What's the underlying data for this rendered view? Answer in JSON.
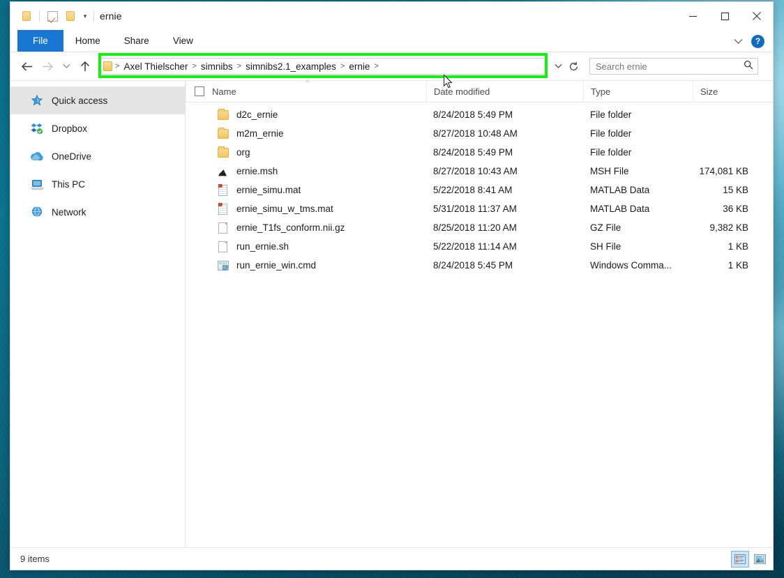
{
  "window": {
    "title": "ernie",
    "quick_access_icons": [
      "folder-icon",
      "properties-checkbox-icon",
      "new-folder-icon",
      "customize-caret-icon"
    ],
    "controls": {
      "minimize": "minimize-button",
      "maximize": "maximize-button",
      "close": "close-button"
    }
  },
  "ribbon": {
    "tabs": [
      {
        "label": "File",
        "active": true
      },
      {
        "label": "Home",
        "active": false
      },
      {
        "label": "Share",
        "active": false
      },
      {
        "label": "View",
        "active": false
      }
    ],
    "expand_icon": "chevron-down-icon",
    "help_label": "?"
  },
  "navbar": {
    "back_icon": "back-arrow-icon",
    "forward_icon": "forward-arrow-icon",
    "recent_icon": "chevron-down-icon",
    "up_icon": "up-arrow-icon",
    "breadcrumb": [
      "Axel Thielscher",
      "simnibs",
      "simnibs2.1_examples",
      "ernie"
    ],
    "breadcrumb_separator": ">",
    "dropdown_icon": "chevron-down-icon",
    "refresh_icon": "refresh-icon",
    "highlight_color": "#14f014"
  },
  "search": {
    "placeholder": "Search ernie",
    "value": "",
    "icon": "search-icon"
  },
  "sidebar": {
    "items": [
      {
        "label": "Quick access",
        "icon": "star-pin-icon",
        "selected": true
      },
      {
        "label": "Dropbox",
        "icon": "dropbox-icon",
        "selected": false
      },
      {
        "label": "OneDrive",
        "icon": "cloud-icon",
        "selected": false
      },
      {
        "label": "This PC",
        "icon": "computer-icon",
        "selected": false
      },
      {
        "label": "Network",
        "icon": "network-globe-icon",
        "selected": false
      }
    ]
  },
  "file_list": {
    "columns": [
      "Name",
      "Date modified",
      "Type",
      "Size"
    ],
    "sort_indicator": "^",
    "rows": [
      {
        "name": "d2c_ernie",
        "date": "8/24/2018 5:49 PM",
        "type": "File folder",
        "size": "",
        "icon": "folder-icon"
      },
      {
        "name": "m2m_ernie",
        "date": "8/27/2018 10:48 AM",
        "type": "File folder",
        "size": "",
        "icon": "folder-icon"
      },
      {
        "name": "org",
        "date": "8/24/2018 5:49 PM",
        "type": "File folder",
        "size": "",
        "icon": "folder-icon"
      },
      {
        "name": "ernie.msh",
        "date": "8/27/2018 10:43 AM",
        "type": "MSH File",
        "size": "174,081 KB",
        "icon": "msh-file-icon"
      },
      {
        "name": "ernie_simu.mat",
        "date": "5/22/2018 8:41 AM",
        "type": "MATLAB Data",
        "size": "15 KB",
        "icon": "matlab-file-icon"
      },
      {
        "name": "ernie_simu_w_tms.mat",
        "date": "5/31/2018 11:37 AM",
        "type": "MATLAB Data",
        "size": "36 KB",
        "icon": "matlab-file-icon"
      },
      {
        "name": "ernie_T1fs_conform.nii.gz",
        "date": "8/25/2018 11:20 AM",
        "type": "GZ File",
        "size": "9,382 KB",
        "icon": "generic-file-icon"
      },
      {
        "name": "run_ernie.sh",
        "date": "5/22/2018 11:14 AM",
        "type": "SH File",
        "size": "1 KB",
        "icon": "generic-file-icon"
      },
      {
        "name": "run_ernie_win.cmd",
        "date": "8/24/2018 5:45 PM",
        "type": "Windows Comma...",
        "size": "1 KB",
        "icon": "cmd-file-icon"
      }
    ]
  },
  "statusbar": {
    "item_count": "9 items",
    "views": [
      {
        "name": "details-view",
        "active": true
      },
      {
        "name": "large-icons-view",
        "active": false
      }
    ]
  }
}
